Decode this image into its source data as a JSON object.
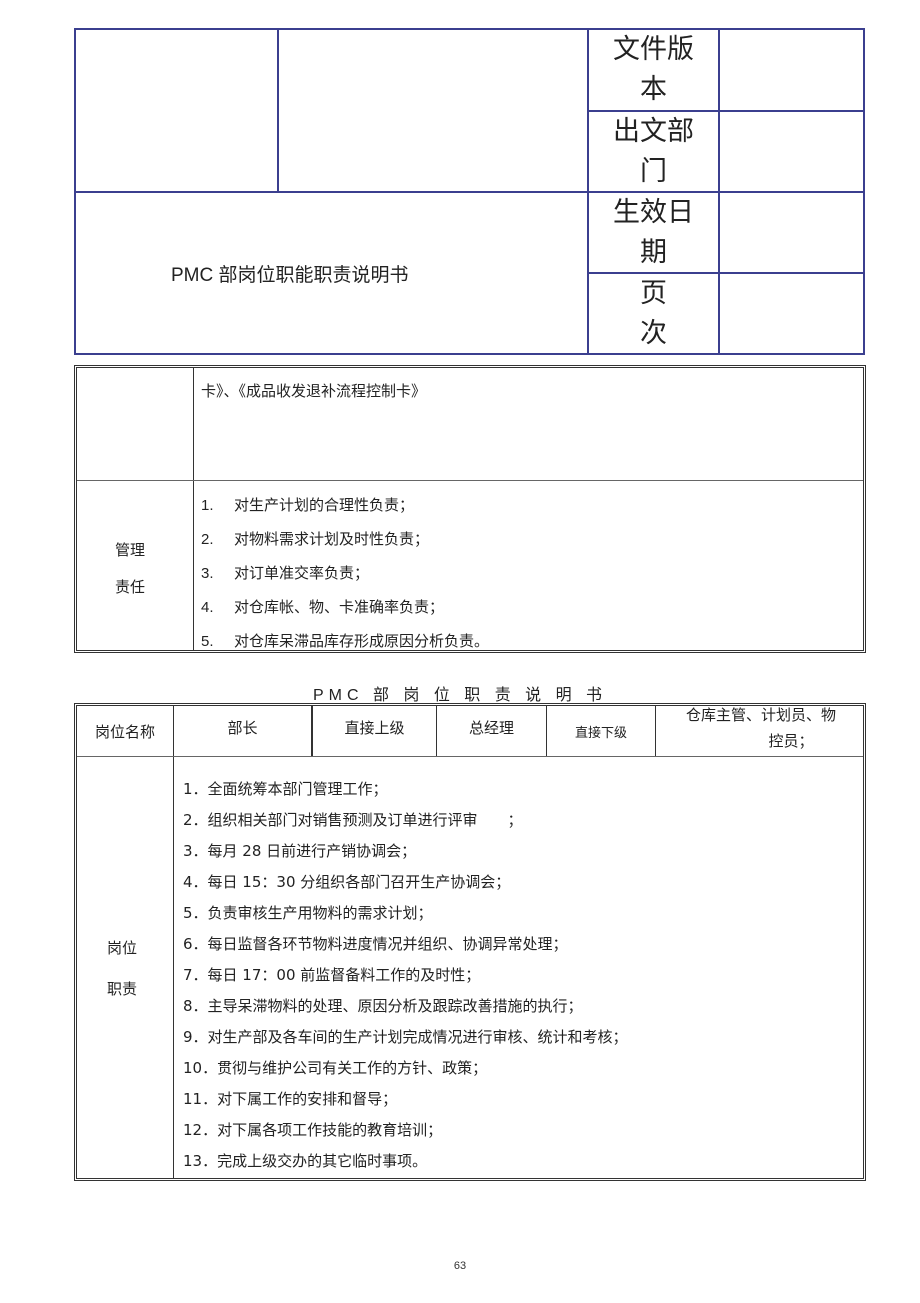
{
  "header": {
    "doc_title": "PMC 部岗位职能职责说明书",
    "fields": [
      {
        "label_line1": "文件版",
        "label_line2": "本",
        "value": ""
      },
      {
        "label_line1": "出文部",
        "label_line2": "门",
        "value": ""
      },
      {
        "label_line1": "生效日",
        "label_line2": "期",
        "value": ""
      },
      {
        "label_line1": "页",
        "label_line2": "次",
        "value": ""
      }
    ]
  },
  "table2": {
    "continued_text": "卡》、《成品收发退补流程控制卡》",
    "management_label_line1": "管理",
    "management_label_line2": "责任",
    "management_items": [
      {
        "num": "1.",
        "text": "对生产计划的合理性负责；"
      },
      {
        "num": "2.",
        "text": "对物料需求计划及时性负责；"
      },
      {
        "num": "3.",
        "text": "对订单准交率负责；"
      },
      {
        "num": "4.",
        "text": "对仓库帐、物、卡准确率负责；"
      },
      {
        "num": "5.",
        "text": "对仓库呆滞品库存形成原因分析负责。"
      }
    ]
  },
  "section_title": "PMC 部 岗 位 职 责 说 明 书",
  "table3": {
    "position_name_label": "岗位名称",
    "position_name_value": "部长",
    "superior_label": "直接上级",
    "superior_value": "总经理",
    "subordinate_label": "直接下级",
    "subordinate_value_line1": "仓库主管、计划员、物",
    "subordinate_value_line2": "控员；",
    "duties_label_line1": "岗位",
    "duties_label_line2": "职责",
    "duties": [
      "1．全面统筹本部门管理工作；",
      "2．组织相关部门对销售预测及订单进行评审　　；",
      "3．每月 28 日前进行产销协调会；",
      "4．每日 15：30 分组织各部门召开生产协调会；",
      "5．负责审核生产用物料的需求计划；",
      "6．每日监督各环节物料进度情况并组织、协调异常处理；",
      "7．每日 17：00 前监督备料工作的及时性；",
      "8．主导呆滞物料的处理、原因分析及跟踪改善措施的执行；",
      "9．对生产部及各车间的生产计划完成情况进行审核、统计和考核；",
      "10．贯彻与维护公司有关工作的方针、政策；",
      "11．对下属工作的安排和督导；",
      "12．对下属各项工作技能的教育培训；",
      "13．完成上级交办的其它临时事项。"
    ]
  },
  "page_number": "63"
}
